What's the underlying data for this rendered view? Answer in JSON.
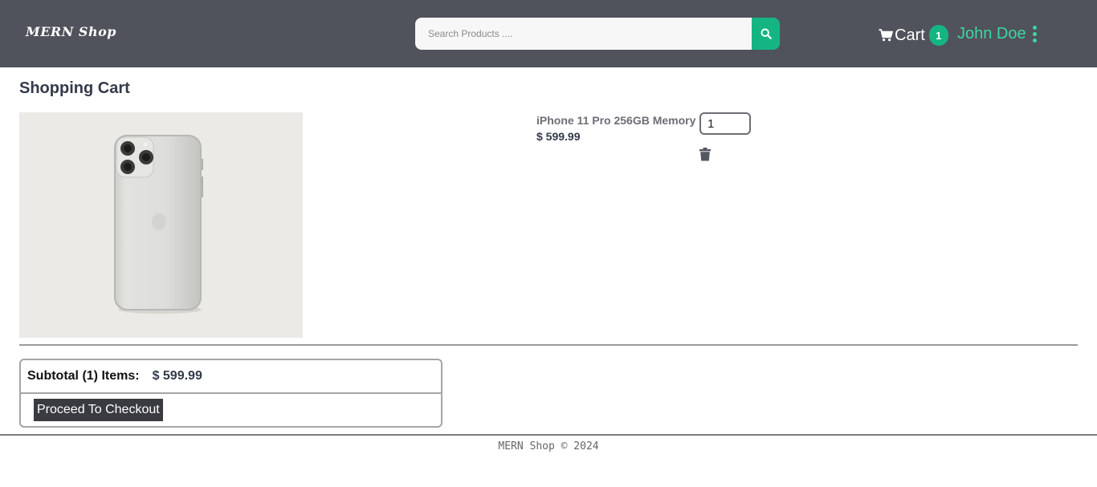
{
  "header": {
    "logo": "MERN Shop",
    "search_placeholder": "Search Products ....",
    "cart_label": "Cart",
    "cart_count": "1",
    "user_name": "John Doe"
  },
  "cart": {
    "title": "Shopping Cart",
    "items": [
      {
        "name": "iPhone 11 Pro 256GB Memory",
        "price": "$ 599.99",
        "quantity": "1"
      }
    ]
  },
  "summary": {
    "subtotal_label": "Subtotal (1) Items:",
    "subtotal_value": "$ 599.99",
    "checkout_label": "Proceed To Checkout"
  },
  "footer": {
    "text": "MERN Shop © 2024"
  },
  "colors": {
    "navbar": "#50525c",
    "accent": "#15b583",
    "user": "#3dd6a0"
  },
  "icons": {
    "search": "search-icon",
    "cart": "cart-icon",
    "menu": "kebab-menu-icon",
    "delete": "trash-icon"
  }
}
